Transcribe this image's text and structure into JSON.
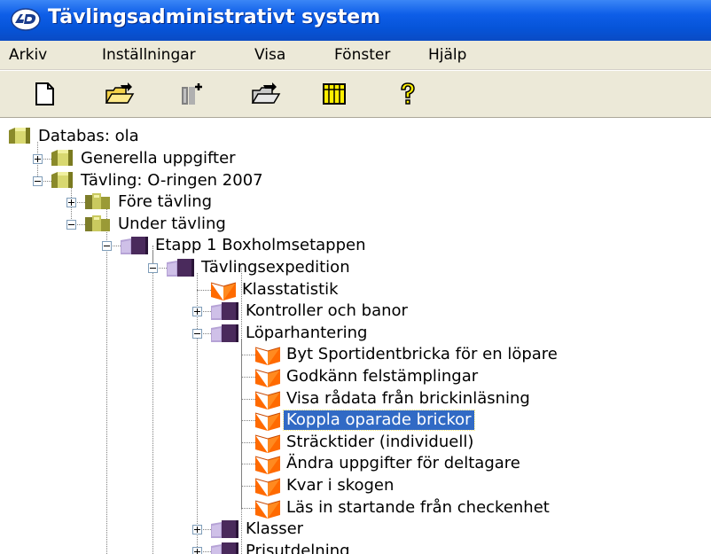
{
  "window": {
    "title": "Tävlingsadministrativt system"
  },
  "menu": {
    "items": [
      "Arkiv",
      "Inställningar",
      "Visa",
      "Fönster",
      "Hjälp"
    ]
  },
  "toolbar": {
    "buttons": [
      "new-document-icon",
      "open-folder-icon",
      "add-column-icon",
      "transfer-folder-icon",
      "table-icon",
      "help-icon"
    ]
  },
  "tree": {
    "nodes": [
      {
        "label": "Databas: ola",
        "icon": "database-icon",
        "expander": "none"
      },
      {
        "label": "Generella uppgifter",
        "icon": "database-icon",
        "expander": "plus"
      },
      {
        "label": "Tävling: O-ringen 2007",
        "icon": "database-icon",
        "expander": "minus"
      },
      {
        "label": "Före tävling",
        "icon": "books-icon",
        "expander": "plus"
      },
      {
        "label": "Under tävling",
        "icon": "books-icon",
        "expander": "minus"
      },
      {
        "label": "Etapp 1 Boxholmsetappen",
        "icon": "purple-folder-icon",
        "expander": "minus"
      },
      {
        "label": "Tävlingsexpedition",
        "icon": "purple-folder-icon",
        "expander": "minus"
      },
      {
        "label": "Klasstatistik",
        "icon": "control-flag-icon",
        "expander": "none"
      },
      {
        "label": "Kontroller och banor",
        "icon": "purple-folder-icon",
        "expander": "plus"
      },
      {
        "label": "Löparhantering",
        "icon": "purple-folder-icon",
        "expander": "minus"
      },
      {
        "label": "Byt Sportidentbricka för en löpare",
        "icon": "control-flag-icon",
        "expander": "none"
      },
      {
        "label": "Godkänn felstämplingar",
        "icon": "control-flag-icon",
        "expander": "none"
      },
      {
        "label": "Visa rådata från brickinläsning",
        "icon": "control-flag-icon",
        "expander": "none"
      },
      {
        "label": "Koppla oparade brickor",
        "icon": "control-flag-icon",
        "expander": "none",
        "selected": true
      },
      {
        "label": "Sträcktider (individuell)",
        "icon": "control-flag-icon",
        "expander": "none"
      },
      {
        "label": "Ändra uppgifter för deltagare",
        "icon": "control-flag-icon",
        "expander": "none"
      },
      {
        "label": "Kvar i skogen",
        "icon": "control-flag-icon",
        "expander": "none"
      },
      {
        "label": "Läs in startande från checkenhet",
        "icon": "control-flag-icon",
        "expander": "none"
      },
      {
        "label": "Klasser",
        "icon": "purple-folder-icon",
        "expander": "plus"
      },
      {
        "label": "Prisutdelning",
        "icon": "purple-folder-icon",
        "expander": "plus"
      }
    ]
  }
}
